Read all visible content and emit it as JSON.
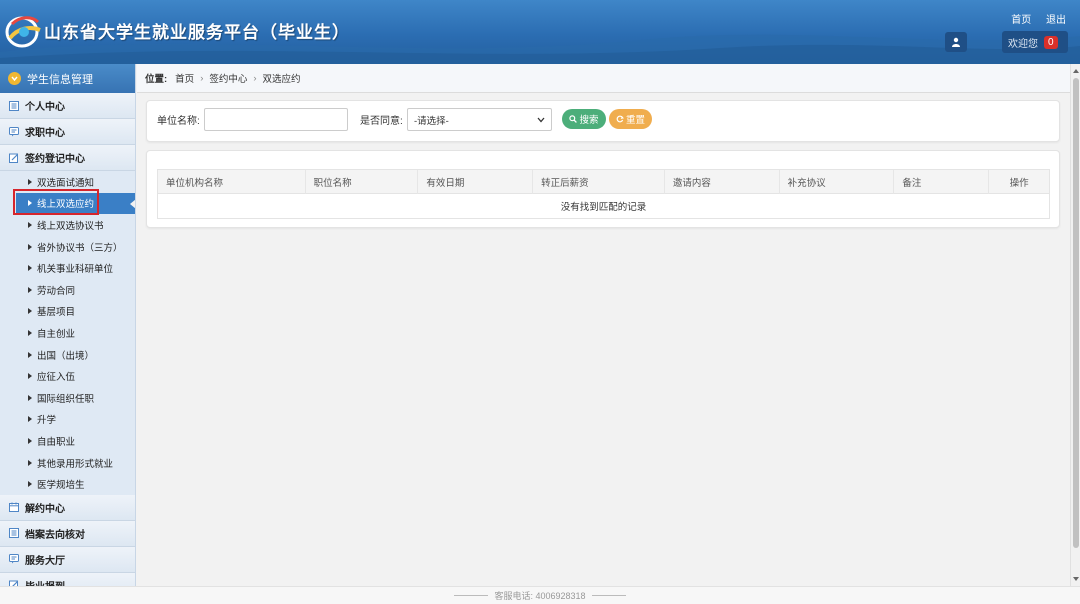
{
  "header": {
    "site_title": "山东省大学生就业服务平台（毕业生）",
    "links": [
      "首页",
      "退出"
    ],
    "welcome": "欢迎您",
    "notification_count": "0"
  },
  "sidebar": {
    "top_title": "学生信息管理",
    "sections_top": [
      {
        "label": "个人中心",
        "icon": "list-icon"
      },
      {
        "label": "求职中心",
        "icon": "chat-icon"
      },
      {
        "label": "签约登记中心",
        "icon": "edit-icon"
      }
    ],
    "sub_items": [
      "双选面试通知",
      "线上双选应约",
      "线上双选协议书",
      "省外协议书（三方）",
      "机关事业科研单位",
      "劳动合同",
      "基层项目",
      "自主创业",
      "出国（出境）",
      "应征入伍",
      "国际组织任职",
      "升学",
      "自由职业",
      "其他录用形式就业",
      "医学规培生"
    ],
    "active_index": 1,
    "sections_bottom": [
      {
        "label": "解约中心",
        "icon": "calendar-icon"
      },
      {
        "label": "档案去向核对",
        "icon": "list-icon"
      },
      {
        "label": "服务大厅",
        "icon": "chat-icon"
      },
      {
        "label": "毕业报到",
        "icon": "edit-icon"
      }
    ]
  },
  "breadcrumb": {
    "prefix": "位置:",
    "items": [
      "首页",
      "签约中心",
      "双选应约"
    ]
  },
  "search": {
    "unit_label": "单位名称:",
    "unit_value": "",
    "agree_label": "是否同意:",
    "agree_selected": "-请选择-",
    "search_button": "搜索",
    "reset_button": "重置"
  },
  "table": {
    "columns": [
      "单位机构名称",
      "职位名称",
      "有效日期",
      "转正后薪资",
      "邀请内容",
      "补充协议",
      "备注",
      "操作"
    ],
    "empty_text": "没有找到匹配的记录"
  },
  "footer": {
    "service_phone": "客服电话: 4006928318"
  },
  "colors": {
    "header": "#2b6db2",
    "active_item": "#3a7fc6",
    "search_button": "#4cae7a",
    "reset_button": "#f0ad4e",
    "highlight_border": "#d6252c"
  }
}
